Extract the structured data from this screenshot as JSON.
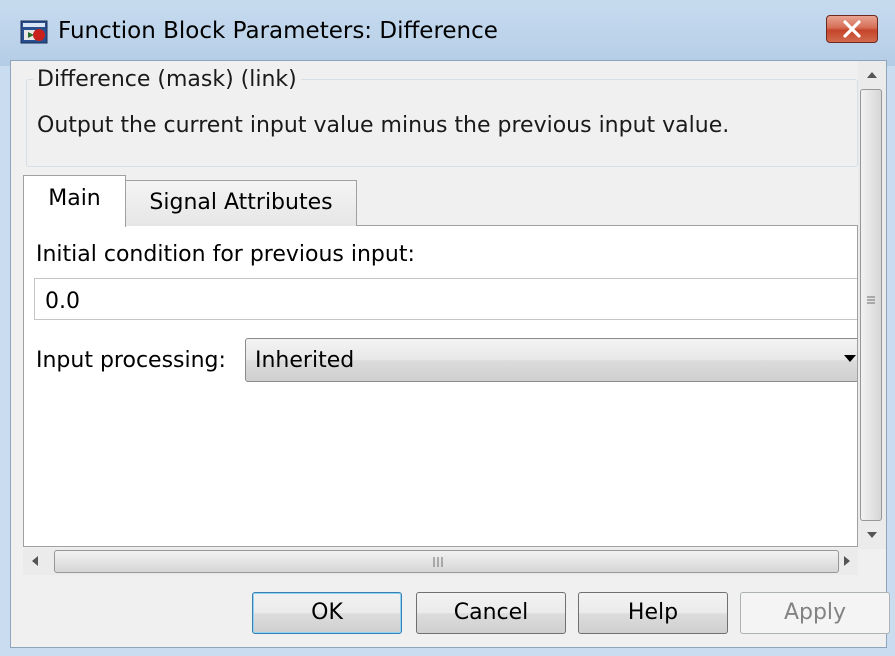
{
  "window": {
    "title": "Function Block Parameters: Difference",
    "icon": "simulink-block-icon",
    "close_icon": "close-icon"
  },
  "description": {
    "group_title": "Difference (mask) (link)",
    "text": "Output the current input value minus the previous input value."
  },
  "tabs": [
    {
      "label": "Main",
      "active": true
    },
    {
      "label": "Signal Attributes",
      "active": false
    }
  ],
  "main": {
    "initial_condition_label": "Initial condition for previous input:",
    "initial_condition_value": "0.0",
    "input_processing_label": "Input processing:",
    "input_processing_value": "Inherited"
  },
  "buttons": {
    "ok": "OK",
    "cancel": "Cancel",
    "help": "Help",
    "apply": "Apply",
    "apply_enabled": false
  },
  "colors": {
    "titlebar": "#bcd3ea",
    "close_button": "#c5442a",
    "dialog_background": "#f0f0f0"
  }
}
